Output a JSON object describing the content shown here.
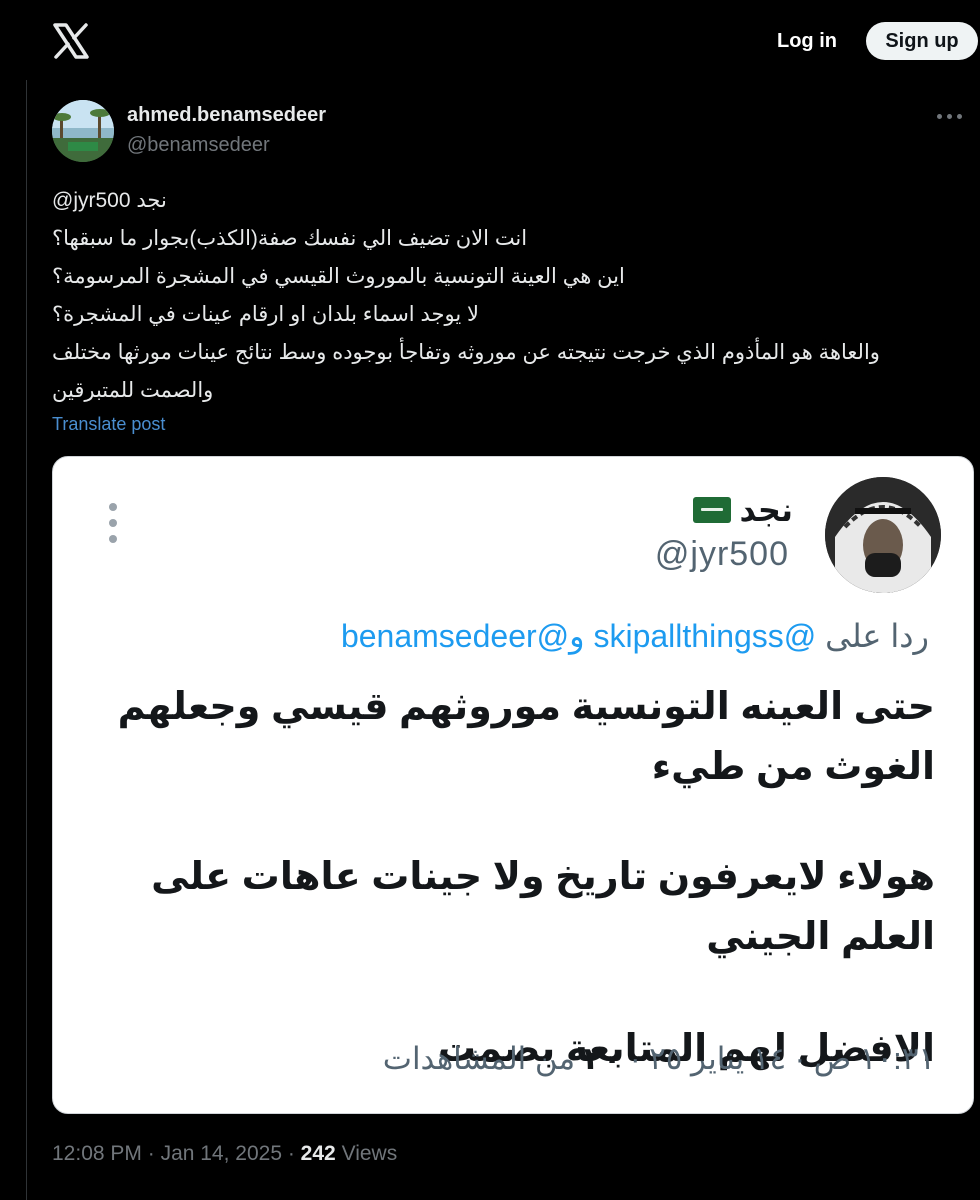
{
  "header": {
    "logo": "x-logo-icon",
    "login_label": "Log in",
    "signup_label": "Sign up"
  },
  "tweet": {
    "author_name": "ahmed.benamsedeer",
    "author_handle": "@benamsedeer",
    "mention_line": "@jyr500  نجد",
    "lines": [
      "انت الان تضيف الي نفسك صفة(الكذب)بجوار ما سبقها؟",
      "اين هي العينة التونسية بالموروث القيسي في المشجرة المرسومة؟",
      "لا يوجد اسماء بلدان او ارقام عينات في المشجرة؟",
      "والعاهة هو المأذوم الذي خرجت نتيجته عن موروثه وتفاجأ بوجوده وسط نتائج عينات مورثها مختلف",
      "والصمت للمتبرقين"
    ],
    "translate_label": "Translate post",
    "time": "12:08 PM",
    "date": "Jan 14, 2025",
    "views_count": "242",
    "views_label": "Views"
  },
  "embedded": {
    "name": "نجد",
    "flag_icon": "saudi-flag-icon",
    "handle": "@jyr500",
    "reply_prefix": "ردا على",
    "reply_handle1": "@skipallthingss",
    "reply_and": "و",
    "reply_handle2": "@benamsedeer",
    "paragraph1": "حتى العينه التونسية موروثهم قيسي وجعلهم الغوث من طيء",
    "paragraph2": "هولاء لايعرفون تاريخ ولا جينات عاهات على العلم الجيني",
    "paragraph3": "الافضل لهم المتابعة بصمت",
    "meta_time": "١٠:٣١ ص",
    "meta_date": "١٤ يناير ٢٥",
    "meta_views": "٣٠",
    "meta_views_label": "من المشاهدات"
  },
  "colors": {
    "background": "#000000",
    "text": "#e7e9ea",
    "secondary": "#71767b",
    "link": "#4a8ed0",
    "card_link": "#1d9bf0"
  }
}
